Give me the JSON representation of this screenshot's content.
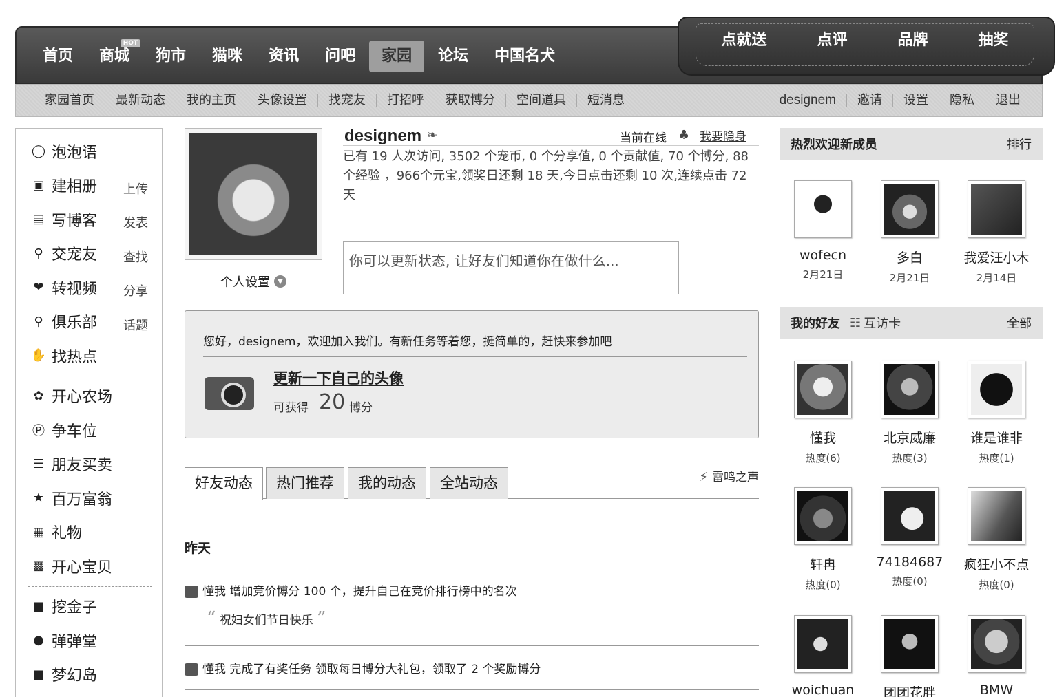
{
  "topnav": {
    "links": [
      "首页",
      "商城",
      "狗市",
      "猫咪",
      "资讯",
      "问吧",
      "家园",
      "论坛",
      "中国名犬"
    ],
    "hot_badge": "HOT",
    "active": "家园",
    "promo": [
      "点就送",
      "点评",
      "品牌",
      "抽奖"
    ]
  },
  "subnav": {
    "left": [
      "家园首页",
      "最新动态",
      "我的主页",
      "头像设置",
      "找宠友",
      "打招呼",
      "获取博分",
      "空间道具",
      "短消息"
    ],
    "right": [
      "designem",
      "邀请",
      "设置",
      "隐私",
      "退出"
    ]
  },
  "sidebar": {
    "items": [
      {
        "icon": "speech-bubble-icon",
        "label": "泡泡语",
        "action": ""
      },
      {
        "icon": "album-icon",
        "label": "建相册",
        "action": "上传"
      },
      {
        "icon": "blog-icon",
        "label": "写博客",
        "action": "发表"
      },
      {
        "icon": "friends-icon",
        "label": "交宠友",
        "action": "查找"
      },
      {
        "icon": "video-icon",
        "label": "转视频",
        "action": "分享"
      },
      {
        "icon": "club-icon",
        "label": "俱乐部",
        "action": "话题"
      },
      {
        "icon": "hot-icon",
        "label": "找热点",
        "action": ""
      }
    ],
    "apps": [
      {
        "icon": "farm-icon",
        "label": "开心农场"
      },
      {
        "icon": "parking-icon",
        "label": "争车位"
      },
      {
        "icon": "trade-icon",
        "label": "朋友买卖"
      },
      {
        "icon": "star-icon",
        "label": "百万富翁"
      },
      {
        "icon": "gift-icon",
        "label": "礼物"
      },
      {
        "icon": "baby-icon",
        "label": "开心宝贝"
      }
    ],
    "games": [
      {
        "icon": "gold-icon",
        "label": "挖金子"
      },
      {
        "icon": "pinball-icon",
        "label": "弹弹堂"
      },
      {
        "icon": "island-icon",
        "label": "梦幻岛"
      }
    ]
  },
  "profile": {
    "username": "designem",
    "online_status": "当前在线",
    "hide_link": "我要隐身",
    "stats": "已有 19 人次访问, 3502 个宠币, 0 个分享值, 0 个贡献值, 70 个博分, 88 个经验 ，966个元宝,领奖日还剩 18 天,今日点击还剩 10 次,连续点击 72 天",
    "personal_settings": "个人设置",
    "status_placeholder": "你可以更新状态, 让好友们知道你在做什么..."
  },
  "task": {
    "welcome": "您好，designem，欢迎加入我们。有新任务等着您，挺简单的，赶快来参加吧",
    "title": "更新一下自己的头像",
    "reward_label": "可获得",
    "points": "20",
    "unit": "博分"
  },
  "tabs": [
    "好友动态",
    "热门推荐",
    "我的动态",
    "全站动态"
  ],
  "thunder_label": "雷鸣之声",
  "feed": {
    "day": "昨天",
    "items": [
      {
        "user": "懂我",
        "text": "增加竞价博分 100 个，提升自己在竞价排行榜中的名次"
      },
      {
        "user": "懂我",
        "text": "完成了有奖任务 领取每日博分大礼包，领取了 2 个奖励博分"
      }
    ],
    "quote": "祝妇女们节日快乐"
  },
  "new_members": {
    "title": "热烈欢迎新成员",
    "more": "排行",
    "users": [
      {
        "name": "wofecn",
        "date": "2月21日"
      },
      {
        "name": "多白",
        "date": "2月21日"
      },
      {
        "name": "我爱汪小木",
        "date": "2月14日"
      }
    ]
  },
  "friends": {
    "title": "我的好友",
    "card_label": "互访卡",
    "more": "全部",
    "users": [
      {
        "name": "懂我",
        "heat": "热度(6)"
      },
      {
        "name": "北京威廉",
        "heat": "热度(3)"
      },
      {
        "name": "谁是谁非",
        "heat": "热度(1)"
      },
      {
        "name": "轩冉",
        "heat": "热度(0)"
      },
      {
        "name": "74184687",
        "heat": "热度(0)"
      },
      {
        "name": "疯狂小不点",
        "heat": "热度(0)"
      },
      {
        "name": "woichuan",
        "heat": ""
      },
      {
        "name": "团团花胖",
        "heat": ""
      },
      {
        "name": "BMW",
        "heat": ""
      }
    ]
  }
}
